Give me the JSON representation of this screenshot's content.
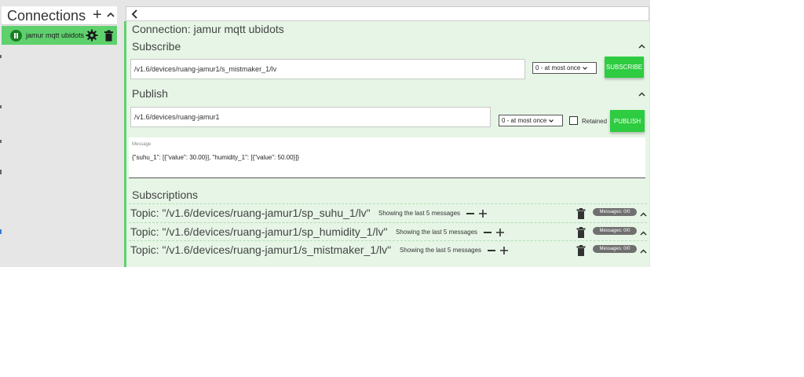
{
  "sidebar": {
    "title": "Connections",
    "add_icon": "plus-icon",
    "collapse_icon": "chevron-up-icon",
    "connection": {
      "name": "jamur mqtt ubidots",
      "status_icon": "pause-icon",
      "settings_icon": "gear-icon",
      "delete_icon": "trash-icon"
    }
  },
  "toolbar": {
    "back_icon": "chevron-left-icon"
  },
  "connection_title": "Connection: jamur mqtt ubidots",
  "subscribe": {
    "title": "Subscribe",
    "topic": "/v1.6/devices/ruang-jamur1/s_mistmaker_1/lv",
    "qos": "0 - at most once",
    "button": "SUBSCRIBE"
  },
  "publish": {
    "title": "Publish",
    "topic": "/v1.6/devices/ruang-jamur1",
    "qos": "0 - at most once",
    "retained_label": "Retained",
    "button": "PUBLISH",
    "message_label": "Message",
    "message": "{\"suhu_1\": [{\"value\": 30.00}], \"humidity_1\": [{\"value\": 50.00}]}"
  },
  "subscriptions": {
    "title": "Subscriptions",
    "items": [
      {
        "topic": "Topic: \"/v1.6/devices/ruang-jamur1/sp_suhu_1/lv\"",
        "showing": "Showing the last 5 messages",
        "badge": "Messages: 0/0"
      },
      {
        "topic": "Topic: \"/v1.6/devices/ruang-jamur1/sp_humidity_1/lv\"",
        "showing": "Showing the last 5 messages",
        "badge": "Messages: 0/0"
      },
      {
        "topic": "Topic: \"/v1.6/devices/ruang-jamur1/s_mistmaker_1/lv\"",
        "showing": "Showing the last 5 messages",
        "badge": "Messages: 0/0"
      }
    ]
  },
  "colors": {
    "accent": "#2ecc40",
    "panel": "#e6f5e6",
    "connection_item": "#5ed16d"
  }
}
